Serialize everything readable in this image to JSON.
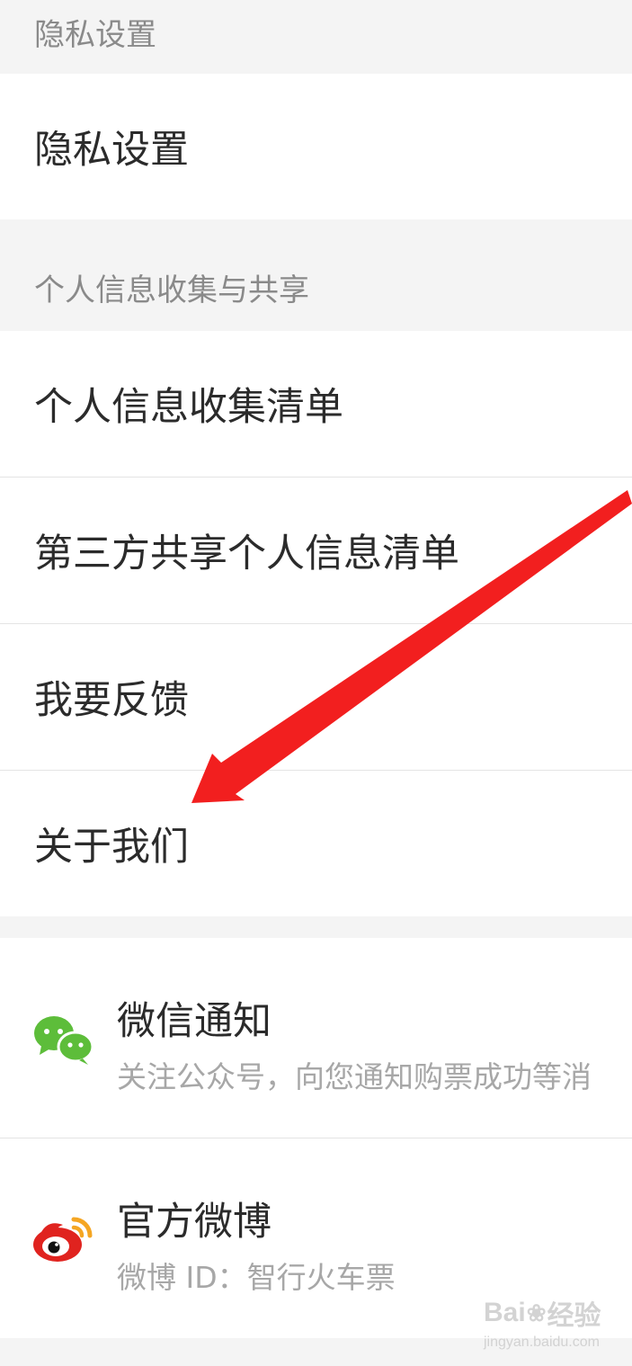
{
  "sections": {
    "privacy_header": "隐私设置",
    "info_header": "个人信息收集与共享"
  },
  "items": {
    "privacy_settings": "隐私设置",
    "info_collection_list": "个人信息收集清单",
    "third_party_sharing_list": "第三方共享个人信息清单",
    "feedback": "我要反馈",
    "about_us": "关于我们"
  },
  "social": {
    "wechat": {
      "title": "微信通知",
      "subtitle": "关注公众号，向您通知购票成功等消",
      "icon": "wechat-icon"
    },
    "weibo": {
      "title": "官方微博",
      "subtitle": "微博 ID：智行火车票",
      "icon": "weibo-icon"
    }
  },
  "annotation": {
    "arrow_color": "#f21f1f",
    "icon": "red-arrow"
  },
  "watermark": {
    "logo_text_left": "Bai",
    "logo_text_right": "经验",
    "url": "jingyan.baidu.com"
  },
  "colors": {
    "background": "#f4f4f4",
    "item_bg": "#ffffff",
    "wechat_green": "#5dbd3a",
    "weibo_red": "#e0231f"
  }
}
